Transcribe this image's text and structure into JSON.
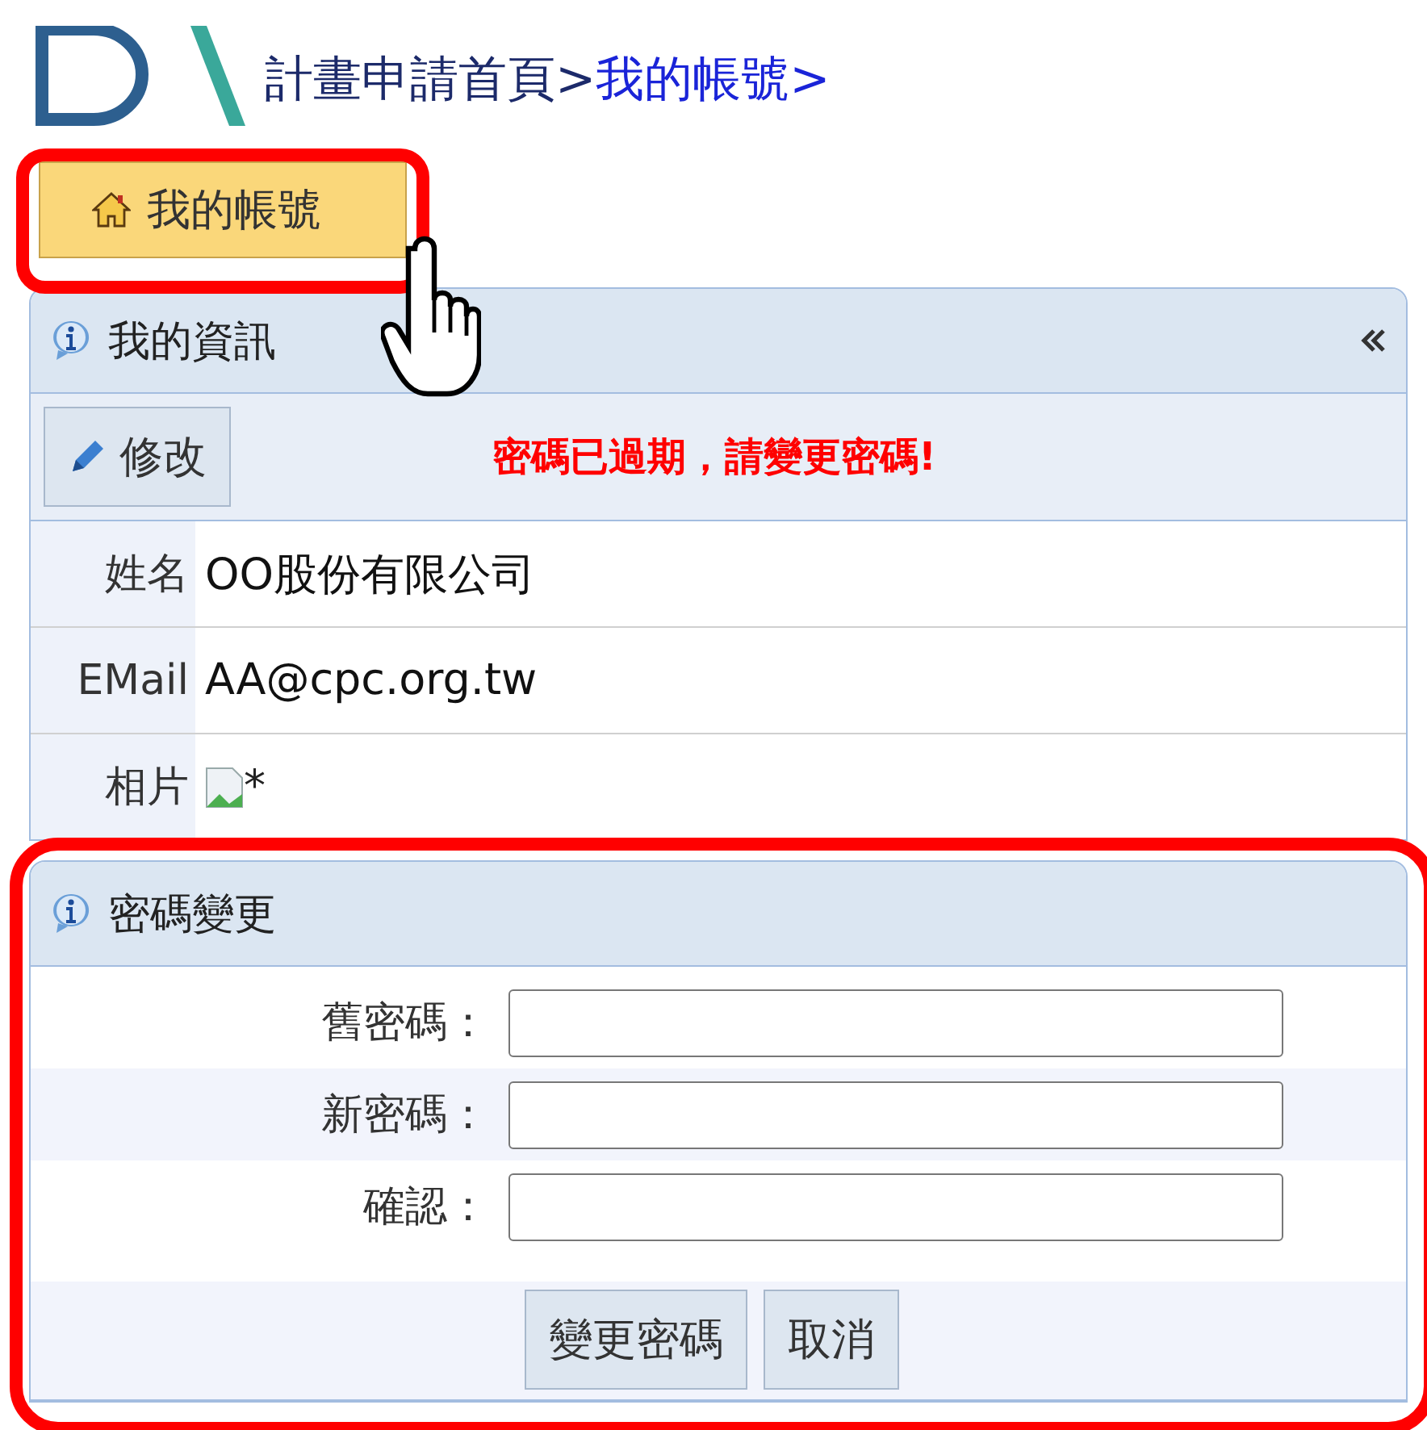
{
  "breadcrumb": [
    {
      "label": "計畫申請首頁>",
      "current": false
    },
    {
      "label": "我的帳號>",
      "current": true
    }
  ],
  "home_button": {
    "label": "我的帳號",
    "highlighted": true
  },
  "info_panel": {
    "title": "我的資訊",
    "edit_button": "修改",
    "message": "密碼已過期，請變更密碼!",
    "rows": [
      {
        "kind": "text",
        "label": "姓名",
        "value": "OO股份有限公司"
      },
      {
        "kind": "text",
        "label": "EMail",
        "value": "AA@cpc.org.tw"
      },
      {
        "kind": "image",
        "label": "相片",
        "value": "*"
      }
    ]
  },
  "password_panel": {
    "title": "密碼變更",
    "highlighted": true,
    "fields": [
      {
        "label": "舊密碼："
      },
      {
        "label": "新密碼："
      },
      {
        "label": "確認："
      }
    ],
    "buttons": [
      "變更密碼",
      "取消"
    ]
  }
}
